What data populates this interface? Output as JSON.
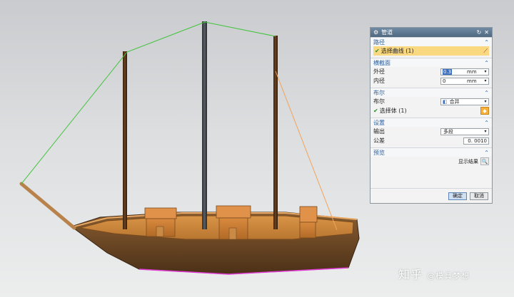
{
  "dialog": {
    "title": "管道",
    "sections": {
      "path": {
        "header": "路径",
        "select_label": "选择曲线 (1)"
      },
      "cross_section": {
        "header": "横截面",
        "outer_label": "外径",
        "outer_value": "0.3",
        "outer_unit": "mm",
        "inner_label": "内径",
        "inner_value": "0",
        "inner_unit": "mm"
      },
      "boolean": {
        "header": "布尔",
        "bool_label": "布尔",
        "bool_value": "合并",
        "select_label": "选择体 (1)"
      },
      "settings": {
        "header": "设置",
        "output_label": "输出",
        "output_value": "多段",
        "tolerance_label": "公差",
        "tolerance_value": "0. 0010"
      },
      "preview": {
        "header": "预览",
        "show_result_label": "显示结果"
      }
    },
    "ok_label": "确定",
    "cancel_label": "取消"
  },
  "watermark": {
    "site": "知乎",
    "author": "@模具梦想"
  },
  "colors": {
    "rigging_green": "#41c43b",
    "rigging_orange": "#f2a45a",
    "hull_brown": "#6a4624",
    "deck_orange": "#c8853a",
    "title_bar": "#5a748c"
  }
}
